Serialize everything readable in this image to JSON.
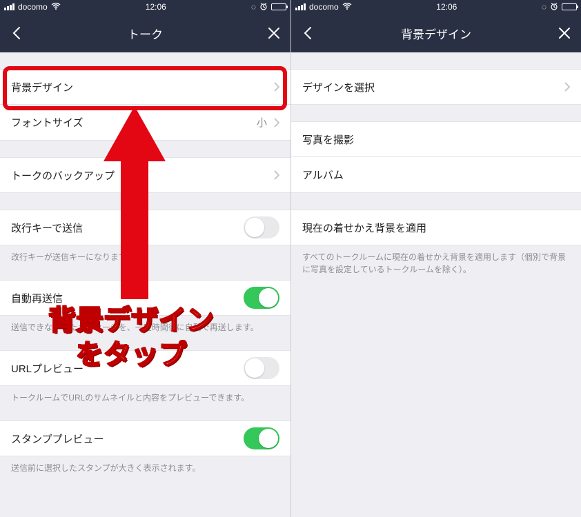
{
  "statusbar": {
    "carrier": "docomo",
    "time": "12:06"
  },
  "left": {
    "title": "トーク",
    "rows": {
      "bg": {
        "label": "背景デザイン"
      },
      "font": {
        "label": "フォントサイズ",
        "value": "小"
      },
      "backup": {
        "label": "トークのバックアップ"
      },
      "enter_send": {
        "label": "改行キーで送信",
        "note": "改行キーが送信キーになります。"
      },
      "auto_resend": {
        "label": "自動再送信",
        "note": "送信できなかったメッセージを、一定時間後に自動で再送します。"
      },
      "url_preview": {
        "label": "URLプレビュー",
        "note": "トークルームでURLのサムネイルと内容をプレビューできます。"
      },
      "stamp_preview": {
        "label": "スタンププレビュー",
        "note": "送信前に選択したスタンプが大きく表示されます。"
      }
    }
  },
  "right": {
    "title": "背景デザイン",
    "rows": {
      "select_design": {
        "label": "デザインを選択"
      },
      "take_photo": {
        "label": "写真を撮影"
      },
      "album": {
        "label": "アルバム"
      },
      "apply_theme": {
        "label": "現在の着せかえ背景を適用",
        "note": "すべてのトークルームに現在の着せかえ背景を適用します（個別で背景に写真を設定しているトークルームを除く）。"
      }
    }
  },
  "callout": {
    "line1": "背景デザイン",
    "line2": "をタップ"
  }
}
